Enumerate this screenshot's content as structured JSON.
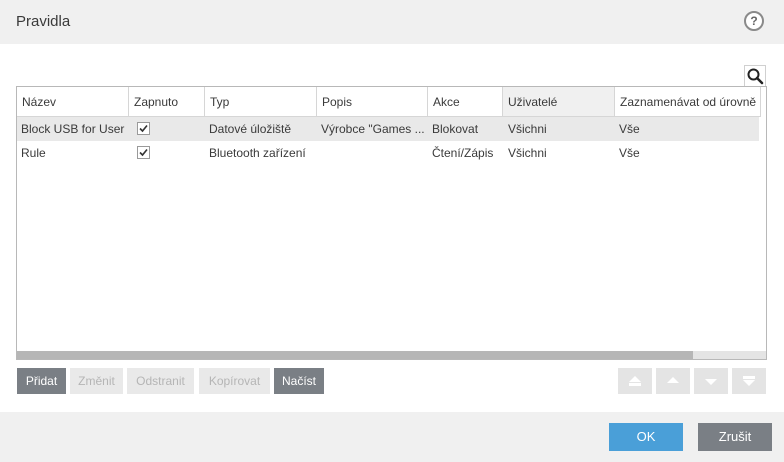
{
  "dialog": {
    "title": "Pravidla",
    "help_label": "?"
  },
  "table": {
    "columns": [
      "Název",
      "Zapnuto",
      "Typ",
      "Popis",
      "Akce",
      "Uživatelé",
      "Zaznamenávat od úrovně"
    ],
    "rows": [
      {
        "name": "Block USB for User",
        "enabled": true,
        "type": "Datové úložiště",
        "description": "Výrobce \"Games ...",
        "action": "Blokovat",
        "users": "Všichni",
        "log_level": "Vše"
      },
      {
        "name": "Rule",
        "enabled": true,
        "type": "Bluetooth zařízení",
        "description": "",
        "action": "Čtení/Zápis",
        "users": "Všichni",
        "log_level": "Vše"
      }
    ]
  },
  "toolbar": {
    "add": "Přidat",
    "edit": "Změnit",
    "remove": "Odstranit",
    "copy": "Kopírovat",
    "load": "Načíst"
  },
  "footer": {
    "ok": "OK",
    "cancel": "Zrušit"
  },
  "colors": {
    "ok_accent": "#4a9fd8",
    "button_dark": "#7a7f85"
  }
}
